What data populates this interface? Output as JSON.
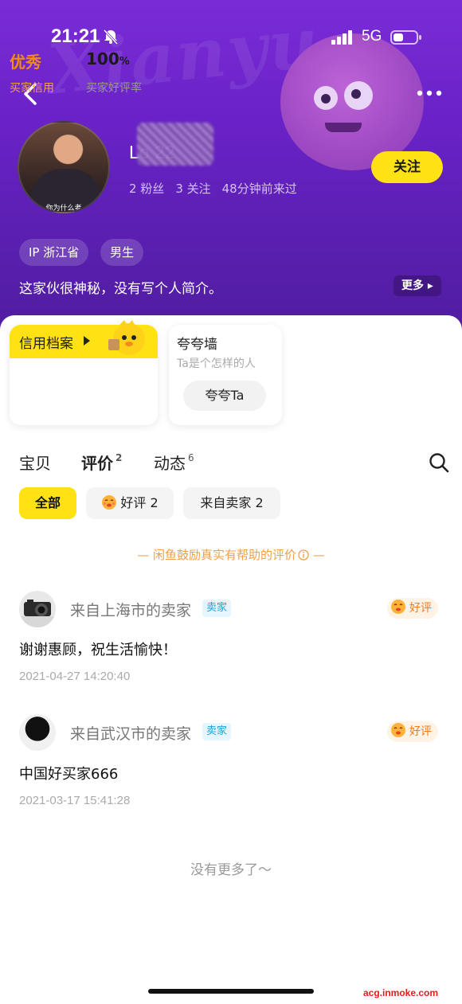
{
  "status": {
    "time": "21:21",
    "network": "5G"
  },
  "header": {
    "watermark": "Xianyu",
    "username": "Lo        22",
    "followers": "2 粉丝",
    "following": "3 关注",
    "last_seen": "48分钟前来过",
    "follow_label": "关注",
    "avatar_caption": "你为什么老",
    "tags": {
      "ip": "IP 浙江省",
      "gender": "男生"
    },
    "bio": "这家伙很神秘，没有写个人简介。",
    "bio_more": "更多 ▸"
  },
  "credit": {
    "title": "信用档案",
    "level": "优秀",
    "level_label": "买家信用",
    "rate_value": "100",
    "rate_unit": "%",
    "rate_label": "买家好评率"
  },
  "praise": {
    "title": "夸夸墙",
    "subtitle": "Ta是个怎样的人",
    "button": "夸夸Ta"
  },
  "tabs": [
    {
      "label": "宝贝",
      "count": ""
    },
    {
      "label": "评价",
      "count": "2"
    },
    {
      "label": "动态",
      "count": "6"
    }
  ],
  "filters": {
    "all": "全部",
    "good": "好评 2",
    "seller": "来自卖家 2"
  },
  "notice": "— 闲鱼鼓励真实有帮助的评价",
  "notice_end": " —",
  "reviews": [
    {
      "from": "来自上海市的卖家",
      "badge": "卖家",
      "rating": "好评",
      "text": "谢谢惠顾，祝生活愉快！",
      "date": "2021-04-27 14:20:40"
    },
    {
      "from": "来自武汉市的卖家",
      "badge": "卖家",
      "rating": "好评",
      "text": "中国好买家666",
      "date": "2021-03-17 15:41:28"
    }
  ],
  "end_text": "没有更多了～",
  "site_watermark": "acg.inmoke.com",
  "colors": {
    "header": "#6a22c8",
    "accent": "#ffe214",
    "credit_orange": "#f08a1d",
    "badge_blue": "#1aa3e0"
  }
}
